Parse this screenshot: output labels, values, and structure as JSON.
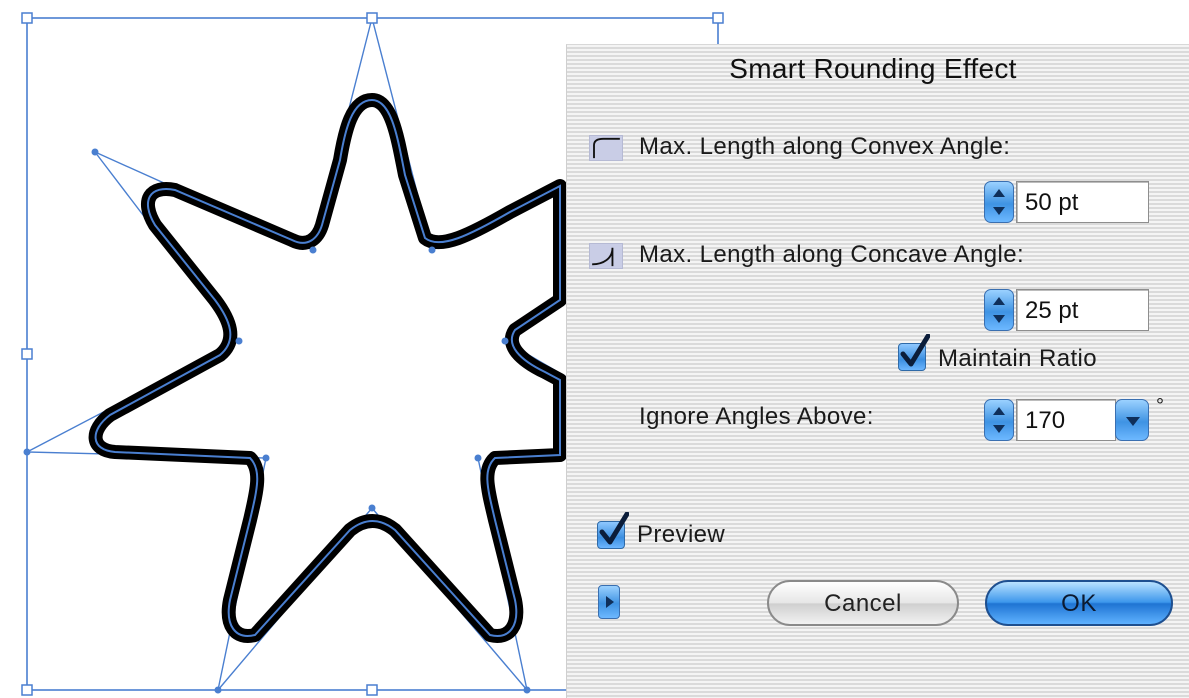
{
  "dialog": {
    "title": "Smart Rounding Effect",
    "convex": {
      "label": "Max. Length along Convex Angle:",
      "value": "50 pt",
      "icon": "convex-angle-icon"
    },
    "concave": {
      "label": "Max. Length along Concave Angle:",
      "value": "25 pt",
      "icon": "concave-angle-icon"
    },
    "maintain_ratio": {
      "label": "Maintain Ratio",
      "checked": true
    },
    "ignore_angles": {
      "label": "Ignore Angles Above:",
      "value": "170",
      "unit": "°"
    },
    "preview": {
      "label": "Preview",
      "checked": true
    },
    "buttons": {
      "cancel": "Cancel",
      "ok": "OK"
    }
  },
  "canvas": {
    "shape": "seven-point-star",
    "selection_color": "#4a7fd0",
    "stroke_color": "#000000"
  }
}
